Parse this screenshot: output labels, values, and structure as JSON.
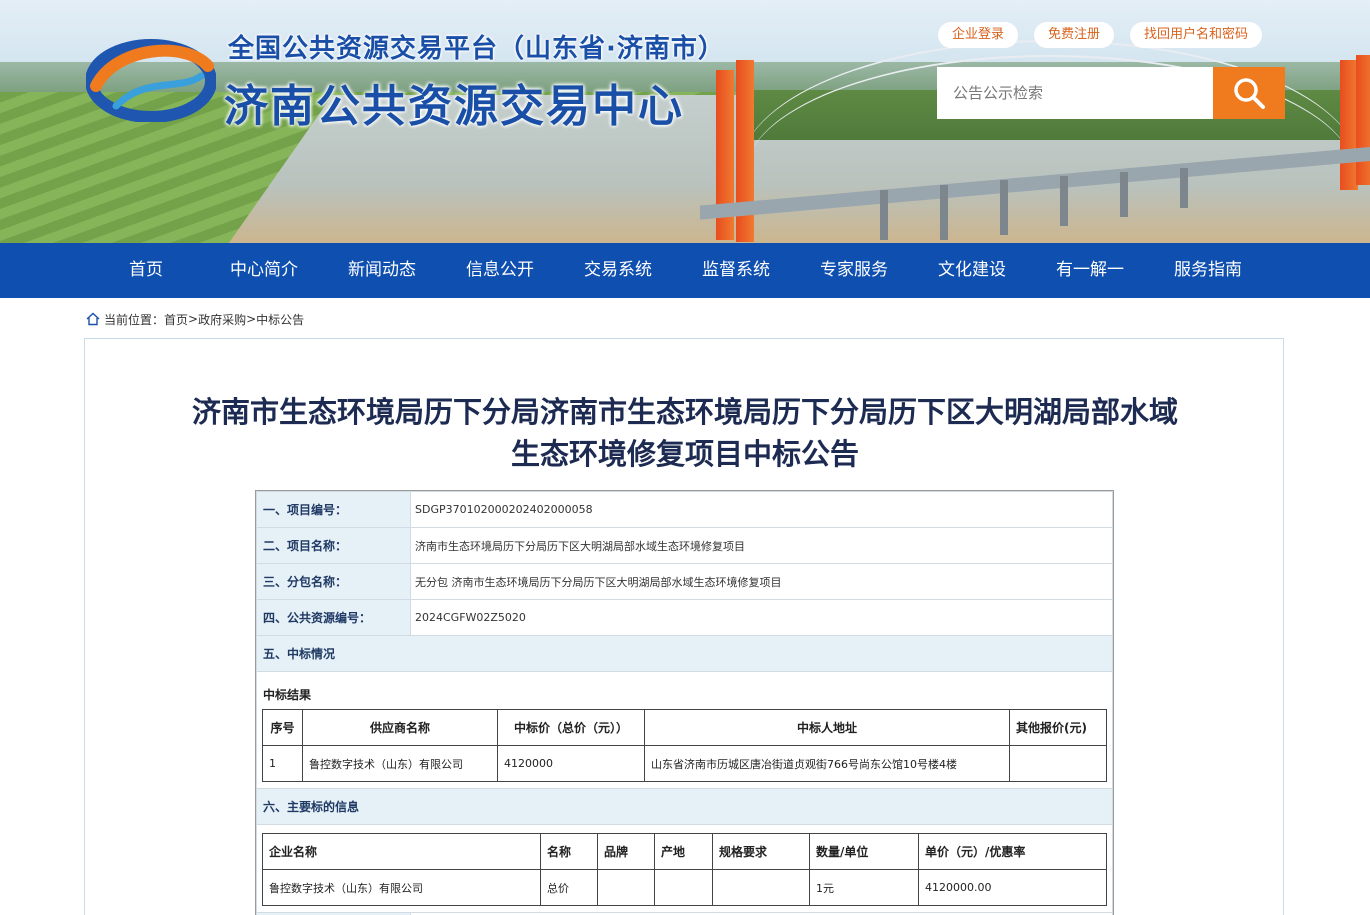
{
  "header": {
    "title_small": "全国公共资源交易平台（山东省·济南市）",
    "title_big": "济南公共资源交易中心",
    "top_links": [
      "企业登录",
      "免费注册",
      "找回用户名和密码"
    ],
    "search_placeholder": "公告公示检索"
  },
  "nav": {
    "items": [
      "首页",
      "中心简介",
      "新闻动态",
      "信息公开",
      "交易系统",
      "监督系统",
      "专家服务",
      "文化建设",
      "有一解一",
      "服务指南"
    ]
  },
  "breadcrumb": {
    "prefix": "当前位置：",
    "home": "首页",
    "sep1": " >",
    "level1": "政府采购",
    "sep2": ">",
    "level2": "中标公告"
  },
  "article": {
    "title_line1": "济南市生态环境局历下分局济南市生态环境局历下分局历下区大明湖局部水域",
    "title_line2": "生态环境修复项目中标公告"
  },
  "fields": [
    {
      "label": "一、项目编号：",
      "value": "SDGP370102000202402000058"
    },
    {
      "label": "二、项目名称：",
      "value": "济南市生态环境局历下分局历下区大明湖局部水域生态环境修复项目"
    },
    {
      "label": "三、分包名称：",
      "value": "无分包 济南市生态环境局历下分局历下区大明湖局部水域生态环境修复项目"
    },
    {
      "label": "四、公共资源编号：",
      "value": "2024CGFW02Z5020"
    }
  ],
  "section5": {
    "heading": "五、中标情况",
    "sub_title": "中标结果",
    "columns": [
      "序号",
      "供应商名称",
      "中标价（总价（元））",
      "中标人地址",
      "其他报价(元)"
    ],
    "rows": [
      {
        "no": "1",
        "supplier": "鲁控数字技术（山东）有限公司",
        "price": "4120000",
        "address": "山东省济南市历城区唐冶街道贞观街766号尚东公馆10号楼4楼",
        "other": ""
      }
    ]
  },
  "section6": {
    "heading": "六、主要标的信息",
    "columns": [
      "企业名称",
      "名称",
      "品牌",
      "产地",
      "规格要求",
      "数量/单位",
      "单价（元）/优惠率"
    ],
    "rows": [
      {
        "company": "鲁控数字技术（山东）有限公司",
        "name": "总价",
        "brand": "",
        "origin": "",
        "spec": "",
        "qty": "1元",
        "unit_price": "4120000.00"
      }
    ]
  },
  "colors": {
    "nav_bg": "#0f4fb0",
    "title_blue": "#1a4fa8",
    "accent_orange": "#f07a1e",
    "label_bg": "#e6f0f7"
  }
}
